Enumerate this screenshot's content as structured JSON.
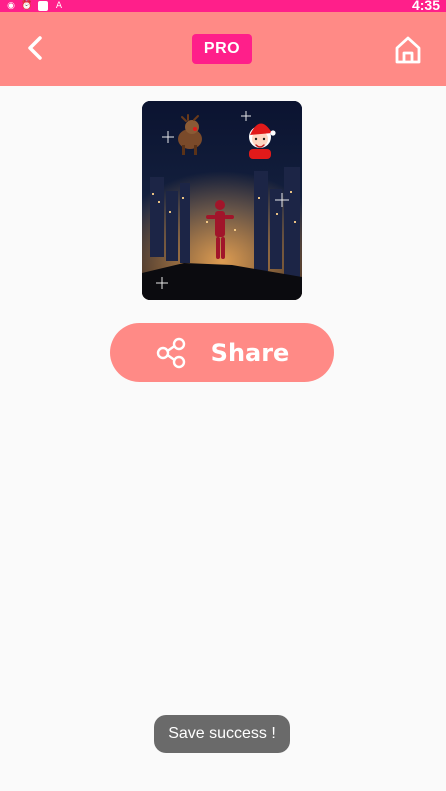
{
  "status_bar": {
    "time": "4:35",
    "icons": [
      "settings-icon",
      "alarm-icon",
      "notification-icon",
      "a-icon"
    ]
  },
  "app_bar": {
    "pro_label": "PRO",
    "colors": {
      "bar": "#ff8a86",
      "pro": "#ff1f8a"
    }
  },
  "preview": {
    "image_name": "christmas-night-city-photo"
  },
  "share": {
    "label": "Share"
  },
  "toast": {
    "text": "Save success !"
  }
}
